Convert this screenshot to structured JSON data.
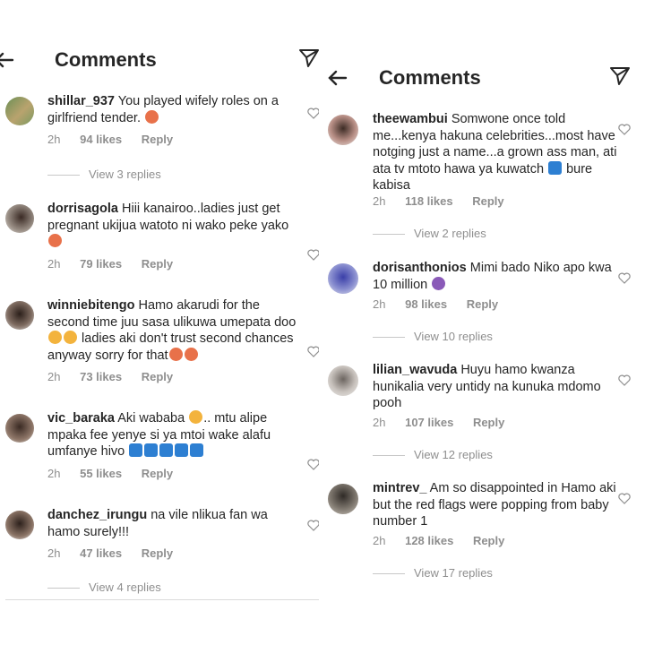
{
  "left": {
    "title": "Comments",
    "comments": [
      {
        "user": "shillar_937",
        "text": " You played wifely roles on a girlfriend tender. ",
        "time": "2h",
        "likes": "94 likes",
        "reply": "Reply",
        "view_replies": "View 3 replies"
      },
      {
        "user": "dorrisagola",
        "text": " Hiii kanairoo..ladies just get pregnant ukijua watoto ni wako peke yako",
        "time": "2h",
        "likes": "79 likes",
        "reply": "Reply"
      },
      {
        "user": "winniebitengo",
        "text": " Hamo akarudi for the second time juu sasa ulikuwa umepata doo ",
        "text2": " ladies aki don't trust second chances anyway sorry for that",
        "time": "2h",
        "likes": "73 likes",
        "reply": "Reply"
      },
      {
        "user": "vic_baraka",
        "text": " Aki wababa ",
        "text2": ".. mtu alipe mpaka fee yenye si ya mtoi wake alafu umfanye hivo ",
        "time": "2h",
        "likes": "55 likes",
        "reply": "Reply"
      },
      {
        "user": "danchez_irungu",
        "text": " na vile nlikua fan wa hamo surely!!!",
        "time": "2h",
        "likes": "47 likes",
        "reply": "Reply",
        "view_replies": "View 4 replies"
      }
    ]
  },
  "right": {
    "title": "Comments",
    "comments": [
      {
        "user": "theewambui",
        "text": " Somwone once told me...kenya hakuna celebrities...most have notging just a name...a grown ass man, ati ata tv mtoto hawa ya kuwatch ",
        "text2": " bure kabisa",
        "time": "2h",
        "likes": "118 likes",
        "reply": "Reply",
        "view_replies": "View 2 replies"
      },
      {
        "user": "dorisanthonios",
        "text": " Mimi bado Niko apo kwa 10 million ",
        "time": "2h",
        "likes": "98 likes",
        "reply": "Reply",
        "view_replies": "View 10 replies"
      },
      {
        "user": "lilian_wavuda",
        "text": " Huyu hamo kwanza hunikalia very untidy na kunuka mdomo pooh",
        "time": "2h",
        "likes": "107 likes",
        "reply": "Reply",
        "view_replies": "View 12 replies"
      },
      {
        "user": "mintrev_",
        "text": " Am so disappointed in Hamo aki but the red flags were popping from baby number 1",
        "time": "2h",
        "likes": "128 likes",
        "reply": "Reply",
        "view_replies": "View 17 replies"
      }
    ]
  },
  "colors": {
    "text": "#262626",
    "muted": "#8e8e8e",
    "divider": "#dbdbdb"
  }
}
